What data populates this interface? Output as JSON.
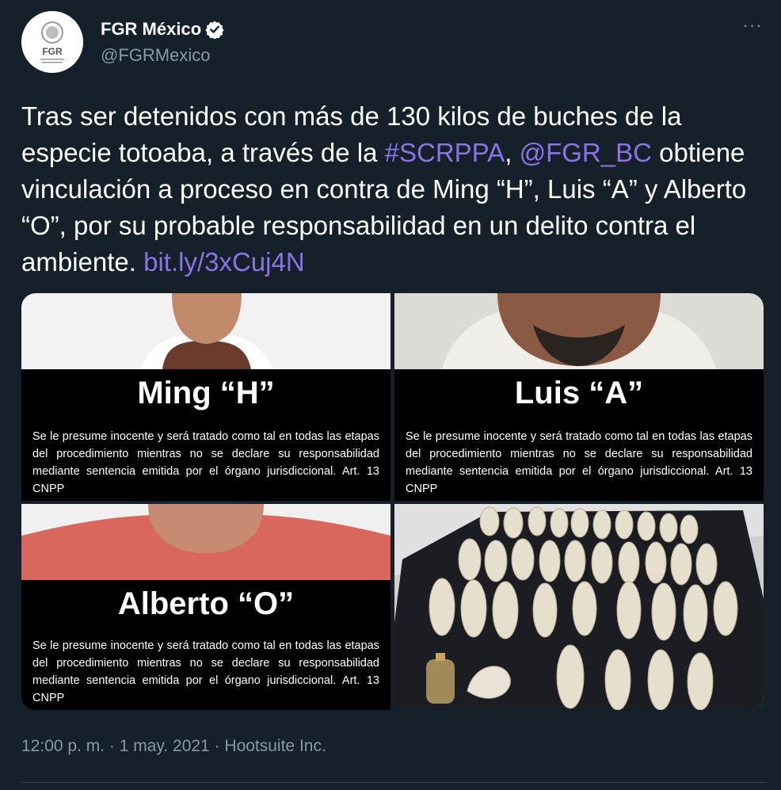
{
  "author": {
    "display_name": "FGR México",
    "handle": "@FGRMexico",
    "avatar_text": "FGR",
    "verified": true
  },
  "menu": {
    "more_label": "···"
  },
  "tweet": {
    "text_1": "Tras ser detenidos con más de 130 kilos de buches de la especie totoaba, a través de la ",
    "hashtag": "#SCRPPA",
    "text_2": ", ",
    "mention": "@FGR_BC",
    "text_3": " obtiene vinculación a proceso en contra de Ming “H”, Luis “A” y Alberto “O”, por su probable responsabilidad en un delito contra el ambiente. ",
    "link": "bit.ly/3xCuj4N"
  },
  "media": {
    "panels": [
      {
        "alias": "Ming “H”",
        "notice": "Se le presume inocente y será tratado como tal en todas las etapas del procedimiento mientras no se declare su responsabilidad mediante sentencia emitida por el órgano jurisdiccional. Art. 13 CNPP"
      },
      {
        "alias": "Luis “A”",
        "notice": "Se le presume inocente y será tratado como tal en todas las etapas del procedimiento mientras no se declare su responsabilidad mediante sentencia emitida por el órgano jurisdiccional. Art. 13 CNPP"
      },
      {
        "alias": "Alberto “O”",
        "notice": "Se le presume inocente y será tratado como tal en todas las etapas del procedimiento mientras no se declare su responsabilidad mediante sentencia emitida por el órgano jurisdiccional. Art. 13 CNPP"
      }
    ]
  },
  "timestamp": "12:00 p. m. · 1 may. 2021 · Hootsuite Inc.",
  "colors": {
    "background": "#15202b",
    "link": "#8b73e5",
    "secondary_text": "#8899a6"
  }
}
